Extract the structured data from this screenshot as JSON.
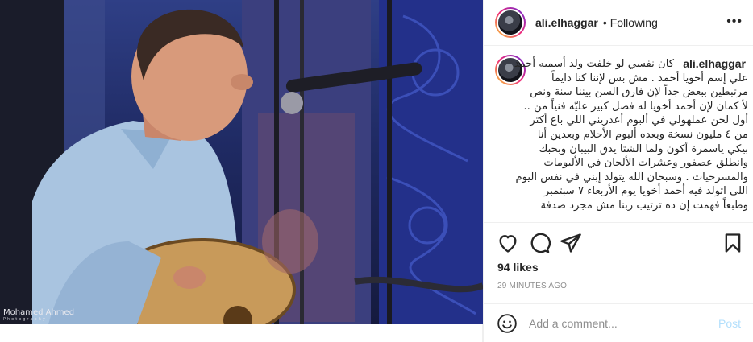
{
  "photo": {
    "watermark_name": "Mohamed Ahmed",
    "watermark_sub": "Photography"
  },
  "header": {
    "username": "ali.elhaggar",
    "separator": "•",
    "follow_status": "Following",
    "more_icon": "more-horizontal-icon",
    "more_glyph": "•••"
  },
  "caption": {
    "username": "ali.elhaggar",
    "lines": [
      "كان نفسي لو خلفت ولد أسميه أحمد",
      "علي إسم أخويا أحمد . مش بس لإننا كنا دايماً",
      "مرتبطين ببعض جداً لإن فارق السن بيننا سنة ونص",
      "لأ كمان لإن أحمد أخويا له فضل كبير عليّه فنياً من ..",
      "أول لحن عملهولي في ألبوم أعذريني اللي باع أكتر",
      "من ٤ مليون نسخة وبعده ألبوم الأحلام وبعدين أنا",
      "بيكي ياسمرة أكون ولما الشتا يدق البيبان وبحبك",
      "وانطلق عصفور وعشرات الألحان في الألبومات",
      "والمسرحيات . وسبحان الله يتولد إبني في نفس اليوم",
      "اللي اتولد فيه أحمد أخويا يوم الأربعاء ٧ سبتمبر",
      "وطبعاً فهمت إن ده ترتيب ربنا مش مجرد صدفة"
    ]
  },
  "actions": {
    "like_icon": "heart-icon",
    "comment_icon": "comment-icon",
    "share_icon": "send-icon",
    "save_icon": "bookmark-icon"
  },
  "likes": "94 likes",
  "time_ago": "29 MINUTES AGO",
  "comment_box": {
    "emoji_icon": "smiley-icon",
    "placeholder": "Add a comment...",
    "post_label": "Post"
  },
  "colors": {
    "link_disabled": "#b2dffc",
    "muted": "#8e8e8e",
    "text": "#262626",
    "stage_blue": "#2f3f86"
  }
}
